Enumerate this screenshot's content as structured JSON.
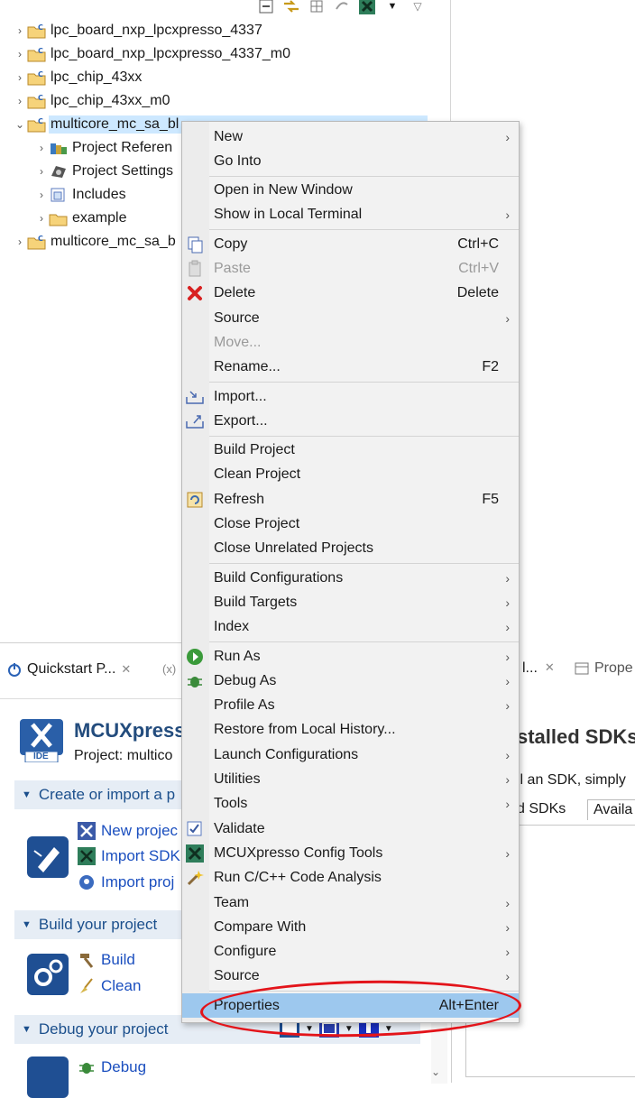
{
  "explorer": {
    "tree": [
      {
        "label": "lpc_board_nxp_lpcxpresso_4337",
        "indent": 0,
        "icon": "project-folder-icon",
        "expanded": false
      },
      {
        "label": "lpc_board_nxp_lpcxpresso_4337_m0",
        "indent": 0,
        "icon": "project-folder-icon",
        "expanded": false
      },
      {
        "label": "lpc_chip_43xx",
        "indent": 0,
        "icon": "project-folder-icon",
        "expanded": false
      },
      {
        "label": "lpc_chip_43xx_m0",
        "indent": 0,
        "icon": "project-folder-icon",
        "expanded": false
      },
      {
        "label": "multicore_mc_sa_bl",
        "indent": 0,
        "icon": "project-folder-icon",
        "expanded": true,
        "selected": true
      },
      {
        "label": "Project Referen",
        "indent": 1,
        "icon": "project-references-icon",
        "expanded": false
      },
      {
        "label": "Project Settings",
        "indent": 1,
        "icon": "project-settings-icon",
        "expanded": false
      },
      {
        "label": "Includes",
        "indent": 1,
        "icon": "includes-icon",
        "expanded": false
      },
      {
        "label": "example",
        "indent": 1,
        "icon": "folder-icon",
        "expanded": false
      },
      {
        "label": "multicore_mc_sa_b",
        "indent": 0,
        "icon": "project-folder-icon",
        "expanded": false
      }
    ]
  },
  "quickstart": {
    "tab_label": "Quickstart P...",
    "vars_tab": "(x)",
    "product_name": "MCUXpress",
    "project_label": "Project: multico",
    "logo_text": "IDE",
    "sections": {
      "create": "Create or import a p",
      "build": "Build your project",
      "debug": "Debug your project"
    },
    "links": {
      "new_project": "New projec",
      "import_sdk": "Import SDK",
      "import_project": "Import proj",
      "build": "Build",
      "clean": "Clean",
      "debug": "Debug"
    }
  },
  "sdk_pane": {
    "tab1": "l...",
    "tab2": "Prope",
    "title": "stalled SDKs",
    "hint": "ll an SDK, simply",
    "subtab1": "d SDKs",
    "subtab2": "Availa"
  },
  "menu": {
    "items": [
      {
        "label": "New",
        "submenu": true
      },
      {
        "label": "Go Into"
      },
      {
        "sep": true
      },
      {
        "label": "Open in New Window"
      },
      {
        "label": "Show in Local Terminal",
        "submenu": true
      },
      {
        "sep": true
      },
      {
        "label": "Copy",
        "shortcut": "Ctrl+C",
        "icon": "copy-icon"
      },
      {
        "label": "Paste",
        "shortcut": "Ctrl+V",
        "icon": "paste-icon",
        "disabled": true
      },
      {
        "label": "Delete",
        "shortcut": "Delete",
        "icon": "delete-icon"
      },
      {
        "label": "Source",
        "submenu": true
      },
      {
        "label": "Move...",
        "disabled": true
      },
      {
        "label": "Rename...",
        "shortcut": "F2"
      },
      {
        "sep": true
      },
      {
        "label": "Import...",
        "icon": "import-icon"
      },
      {
        "label": "Export...",
        "icon": "export-icon"
      },
      {
        "sep": true
      },
      {
        "label": "Build Project"
      },
      {
        "label": "Clean Project"
      },
      {
        "label": "Refresh",
        "shortcut": "F5",
        "icon": "refresh-icon"
      },
      {
        "label": "Close Project"
      },
      {
        "label": "Close Unrelated Projects"
      },
      {
        "sep": true
      },
      {
        "label": "Build Configurations",
        "submenu": true
      },
      {
        "label": "Build Targets",
        "submenu": true
      },
      {
        "label": "Index",
        "submenu": true
      },
      {
        "sep": true
      },
      {
        "label": "Run As",
        "submenu": true,
        "icon": "run-icon"
      },
      {
        "label": "Debug As",
        "submenu": true,
        "icon": "bug-icon"
      },
      {
        "label": "Profile As",
        "submenu": true
      },
      {
        "label": "Restore from Local History..."
      },
      {
        "label": "Launch Configurations",
        "submenu": true
      },
      {
        "label": "Utilities",
        "submenu": true
      },
      {
        "label": "Tools",
        "submenu": true
      },
      {
        "label": "Validate",
        "icon": "checkbox-icon"
      },
      {
        "label": "MCUXpresso Config Tools",
        "submenu": true,
        "icon": "config-tools-icon"
      },
      {
        "label": "Run C/C++ Code Analysis",
        "icon": "wand-icon"
      },
      {
        "label": "Team",
        "submenu": true
      },
      {
        "label": "Compare With",
        "submenu": true
      },
      {
        "label": "Configure",
        "submenu": true
      },
      {
        "label": "Source",
        "submenu": true
      },
      {
        "sep": true
      },
      {
        "label": "Properties",
        "shortcut": "Alt+Enter",
        "highlighted": true
      }
    ]
  },
  "colors": {
    "accent": "#1b4f8c",
    "highlight": "#9dc8ee",
    "annotation": "#e3141a"
  }
}
